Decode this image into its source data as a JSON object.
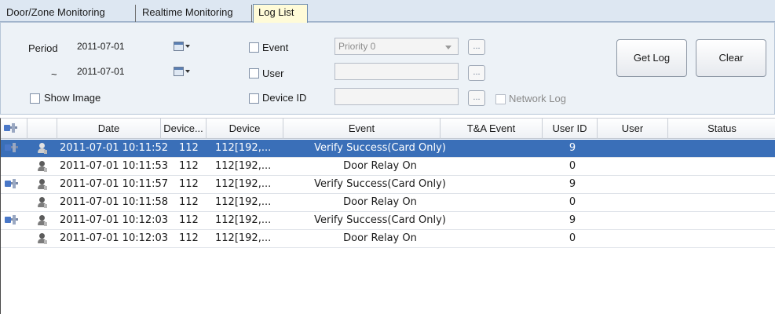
{
  "tabs": [
    {
      "label": "Door/Zone Monitoring"
    },
    {
      "label": "Realtime Monitoring"
    },
    {
      "label": "Log List"
    }
  ],
  "filters": {
    "period_label": "Period",
    "from_date": "2011-07-01",
    "tilde": "~",
    "to_date": "2011-07-01",
    "show_image_label": "Show Image",
    "event_label": "Event",
    "event_value": "Priority 0",
    "user_label": "User",
    "device_id_label": "Device ID",
    "browse_label": "...",
    "network_log_label": "Network Log",
    "get_log_label": "Get Log",
    "clear_label": "Clear"
  },
  "grid": {
    "columns": [
      "Date",
      "Device...",
      "Device",
      "Event",
      "T&A Event",
      "User ID",
      "User",
      "Status"
    ],
    "rows": [
      {
        "date": "2011-07-01 10:11:52",
        "device_id": "112",
        "device": "112[192,...",
        "event": "Verify Success(Card Only)",
        "ta_event": "",
        "user_id": "9",
        "user": "",
        "status": "",
        "icons": "door-user",
        "selected": true
      },
      {
        "date": "2011-07-01 10:11:53",
        "device_id": "112",
        "device": "112[192,...",
        "event": "Door Relay On",
        "ta_event": "",
        "user_id": "0",
        "user": "",
        "status": "",
        "icons": "user"
      },
      {
        "date": "2011-07-01 10:11:57",
        "device_id": "112",
        "device": "112[192,...",
        "event": "Verify Success(Card Only)",
        "ta_event": "",
        "user_id": "9",
        "user": "",
        "status": "",
        "icons": "door-user"
      },
      {
        "date": "2011-07-01 10:11:58",
        "device_id": "112",
        "device": "112[192,...",
        "event": "Door Relay On",
        "ta_event": "",
        "user_id": "0",
        "user": "",
        "status": "",
        "icons": "user"
      },
      {
        "date": "2011-07-01 10:12:03",
        "device_id": "112",
        "device": "112[192,...",
        "event": "Verify Success(Card Only)",
        "ta_event": "",
        "user_id": "9",
        "user": "",
        "status": "",
        "icons": "door-user"
      },
      {
        "date": "2011-07-01 10:12:03",
        "device_id": "112",
        "device": "112[192,...",
        "event": "Door Relay On",
        "ta_event": "",
        "user_id": "0",
        "user": "",
        "status": "",
        "icons": "user"
      }
    ]
  },
  "colors": {
    "selected_row": "#3a6fb8",
    "active_tab": "#fffbd8",
    "panel": "#edf2f7"
  }
}
